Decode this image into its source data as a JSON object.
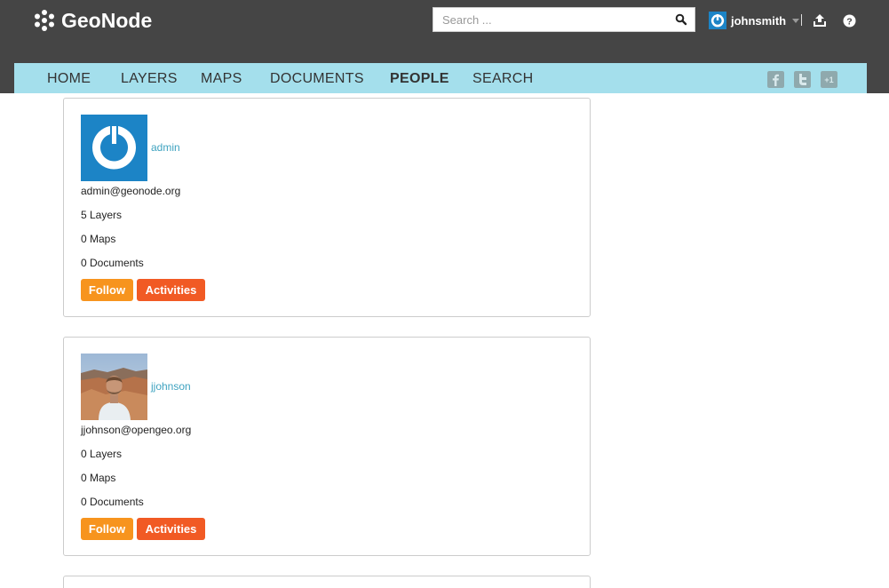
{
  "brand": {
    "name": "GeoNode"
  },
  "search": {
    "placeholder": "Search ...",
    "value": ""
  },
  "user": {
    "name": "johnsmith"
  },
  "nav": {
    "items": [
      {
        "label": "HOME"
      },
      {
        "label": "LAYERS"
      },
      {
        "label": "MAPS"
      },
      {
        "label": "DOCUMENTS"
      },
      {
        "label": "PEOPLE",
        "active": true
      },
      {
        "label": "SEARCH"
      }
    ],
    "social": [
      "facebook-icon",
      "twitter-icon",
      "google-plus-icon"
    ],
    "google_plus_label": "+1"
  },
  "people": [
    {
      "username": "admin",
      "email": "admin@geonode.org",
      "layers": "5 Layers",
      "maps": "0 Maps",
      "documents": "0 Documents",
      "follow_label": "Follow",
      "activities_label": "Activities"
    },
    {
      "username": "jjohnson",
      "email": "jjohnson@opengeo.org",
      "layers": "0 Layers",
      "maps": "0 Maps",
      "documents": "0 Documents",
      "follow_label": "Follow",
      "activities_label": "Activities"
    }
  ],
  "colors": {
    "header": "#454545",
    "nav": "#a4dfec",
    "link": "#3fa3c0",
    "follow": "#f7941e",
    "activities": "#f15a24",
    "geonode_blue": "#1c84c6"
  }
}
